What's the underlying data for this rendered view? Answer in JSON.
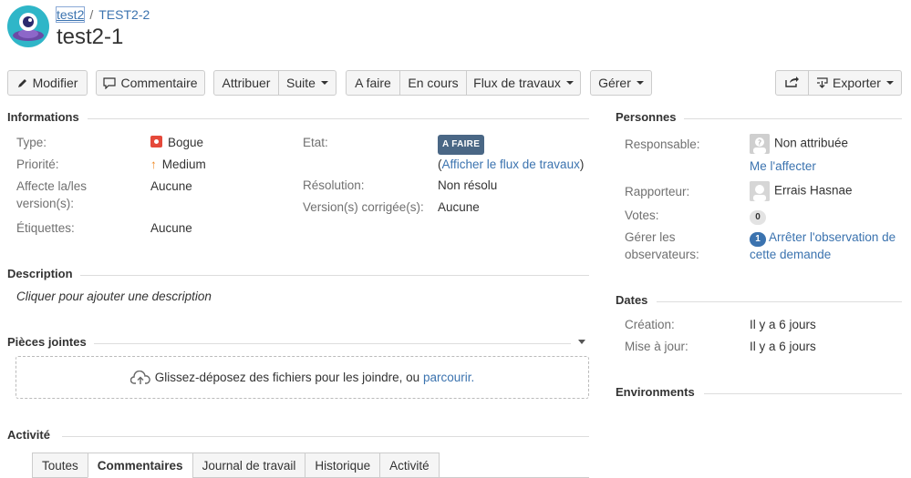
{
  "breadcrumb": {
    "project": "test2",
    "separator": "/",
    "issue_key": "TEST2-2"
  },
  "issue": {
    "title": "test2-1"
  },
  "toolbar": {
    "modifier": "Modifier",
    "commentaire": "Commentaire",
    "attribuer": "Attribuer",
    "suite": "Suite",
    "a_faire": "A faire",
    "en_cours": "En cours",
    "flux": "Flux de travaux",
    "gerer": "Gérer",
    "exporter": "Exporter"
  },
  "informations": {
    "heading": "Informations",
    "type_label": "Type:",
    "type_value": "Bogue",
    "priority_label": "Priorité:",
    "priority_value": "Medium",
    "affects_label_1": "Affecte la/les",
    "affects_label_2": "version(s):",
    "affects_value": "Aucune",
    "labels_label": "Étiquettes:",
    "labels_value": "Aucune",
    "status_label": "Etat:",
    "status_value": "A FAIRE",
    "workflow_open": "(",
    "workflow_link": "Afficher le flux de travaux",
    "workflow_close": ")",
    "resolution_label": "Résolution:",
    "resolution_value": "Non résolu",
    "fix_label": "Version(s) corrigée(s):",
    "fix_value": "Aucune"
  },
  "description": {
    "heading": "Description",
    "placeholder": "Cliquer pour ajouter une description"
  },
  "attachments": {
    "heading": "Pièces jointes",
    "drop_text": "Glissez-déposez des fichiers pour les joindre, ou ",
    "browse_link": "parcourir."
  },
  "activity": {
    "heading": "Activité",
    "tabs": [
      "Toutes",
      "Commentaires",
      "Journal de travail",
      "Historique",
      "Activité"
    ],
    "active_tab": "Commentaires"
  },
  "people": {
    "heading": "Personnes",
    "assignee_label": "Responsable:",
    "assignee_value": "Non attribuée",
    "assign_me": "Me l'affecter",
    "reporter_label": "Rapporteur:",
    "reporter_value": "Errais Hasnae",
    "votes_label": "Votes:",
    "votes_count": "0",
    "watchers_label_1": "Gérer les",
    "watchers_label_2": "observateurs:",
    "watchers_count": "1",
    "watch_link_1": "Arrêter l'observation de",
    "watch_link_2": "cette demande"
  },
  "dates": {
    "heading": "Dates",
    "created_label": "Création:",
    "created_value": "Il y a 6 jours",
    "updated_label": "Mise à jour:",
    "updated_value": "Il y a 6 jours"
  },
  "environments": {
    "heading": "Environments"
  },
  "colors": {
    "link": "#3b73af",
    "status_badge": "#4a6785",
    "bug": "#e5493a",
    "priority": "#f08a24"
  }
}
